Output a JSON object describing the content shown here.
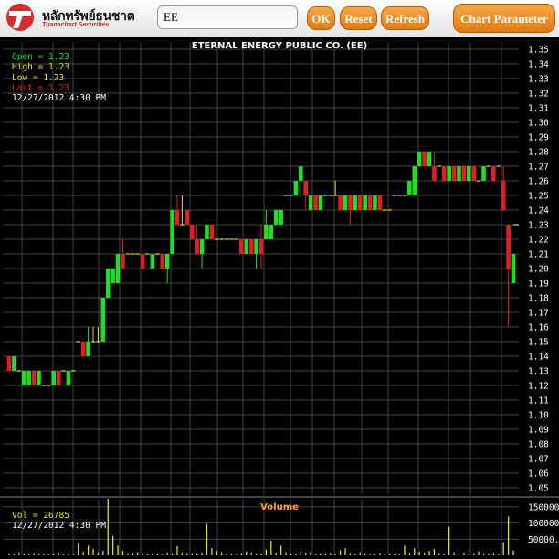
{
  "header": {
    "logo_text": "หลักทรัพย์ธนชาต",
    "logo_subtext": "Thanachart Securities",
    "symbol_value": "EE",
    "ok_label": "OK",
    "reset_label": "Reset",
    "refresh_label": "Refresh",
    "chart_parameter_label": "Chart Parameter"
  },
  "colors": {
    "up": "#22dd22",
    "down": "#e02020",
    "neutral": "#e0e020",
    "volume": "#e0e020",
    "grid": "#5a5a5a",
    "title": "#ffffff",
    "volume_title": "#ffa020",
    "button": "#e88a1a"
  },
  "info": {
    "open_label": "Open  = 1.23",
    "high_label": "High  = 1.23",
    "low_label": "Low   = 1.23",
    "last_label": "Last  = 1.23",
    "datetime": "12/27/2012  4:30 PM",
    "vol_label": "Vol  = 26785",
    "vol_datetime": "12/27/2012  4:30 PM"
  },
  "chart_data": [
    {
      "type": "candlestick",
      "title": "ETERNAL ENERGY PUBLIC CO. (EE)",
      "ylim": [
        1.045,
        1.355
      ],
      "yticks": [
        "1.35",
        "1.34",
        "1.33",
        "1.32",
        "1.31",
        "1.30",
        "1.29",
        "1.28",
        "1.27",
        "1.26",
        "1.25",
        "1.24",
        "1.23",
        "1.22",
        "1.21",
        "1.20",
        "1.19",
        "1.18",
        "1.17",
        "1.16",
        "1.15",
        "1.14",
        "1.13",
        "1.12",
        "1.11",
        "1.10",
        "1.09",
        "1.08",
        "1.07",
        "1.06",
        "1.05"
      ],
      "last_marker": "1.23",
      "grid": true,
      "candles": [
        {
          "o": 1.14,
          "h": 1.14,
          "l": 1.13,
          "c": 1.13
        },
        {
          "o": 1.13,
          "h": 1.14,
          "l": 1.13,
          "c": 1.14
        },
        {
          "o": 1.13,
          "h": 1.13,
          "l": 1.13,
          "c": 1.13
        },
        {
          "o": 1.12,
          "h": 1.13,
          "l": 1.12,
          "c": 1.13
        },
        {
          "o": 1.12,
          "h": 1.13,
          "l": 1.12,
          "c": 1.13
        },
        {
          "o": 1.13,
          "h": 1.13,
          "l": 1.12,
          "c": 1.12
        },
        {
          "o": 1.12,
          "h": 1.13,
          "l": 1.12,
          "c": 1.13
        },
        {
          "o": 1.12,
          "h": 1.12,
          "l": 1.12,
          "c": 1.12
        },
        {
          "o": 1.12,
          "h": 1.12,
          "l": 1.12,
          "c": 1.12
        },
        {
          "o": 1.12,
          "h": 1.13,
          "l": 1.12,
          "c": 1.13
        },
        {
          "o": 1.13,
          "h": 1.13,
          "l": 1.12,
          "c": 1.12
        },
        {
          "o": 1.13,
          "h": 1.13,
          "l": 1.13,
          "c": 1.13
        },
        {
          "o": 1.12,
          "h": 1.13,
          "l": 1.12,
          "c": 1.13
        },
        {
          "o": 1.13,
          "h": 1.13,
          "l": 1.13,
          "c": 1.13
        },
        {
          "o": 1.15,
          "h": 1.15,
          "l": 1.15,
          "c": 1.15
        },
        {
          "o": 1.15,
          "h": 1.15,
          "l": 1.14,
          "c": 1.14
        },
        {
          "o": 1.14,
          "h": 1.16,
          "l": 1.14,
          "c": 1.15
        },
        {
          "o": 1.15,
          "h": 1.16,
          "l": 1.15,
          "c": 1.15
        },
        {
          "o": 1.15,
          "h": 1.16,
          "l": 1.15,
          "c": 1.15
        },
        {
          "o": 1.15,
          "h": 1.18,
          "l": 1.15,
          "c": 1.18
        },
        {
          "o": 1.18,
          "h": 1.2,
          "l": 1.18,
          "c": 1.2
        },
        {
          "o": 1.19,
          "h": 1.2,
          "l": 1.19,
          "c": 1.2
        },
        {
          "o": 1.19,
          "h": 1.21,
          "l": 1.19,
          "c": 1.21
        },
        {
          "o": 1.21,
          "h": 1.22,
          "l": 1.2,
          "c": 1.2
        },
        {
          "o": 1.21,
          "h": 1.21,
          "l": 1.21,
          "c": 1.21
        },
        {
          "o": 1.21,
          "h": 1.21,
          "l": 1.21,
          "c": 1.21
        },
        {
          "o": 1.21,
          "h": 1.21,
          "l": 1.21,
          "c": 1.21
        },
        {
          "o": 1.21,
          "h": 1.21,
          "l": 1.2,
          "c": 1.2
        },
        {
          "o": 1.21,
          "h": 1.21,
          "l": 1.21,
          "c": 1.21
        },
        {
          "o": 1.2,
          "h": 1.21,
          "l": 1.2,
          "c": 1.21
        },
        {
          "o": 1.21,
          "h": 1.21,
          "l": 1.21,
          "c": 1.21
        },
        {
          "o": 1.21,
          "h": 1.21,
          "l": 1.2,
          "c": 1.2
        },
        {
          "o": 1.2,
          "h": 1.21,
          "l": 1.19,
          "c": 1.21
        },
        {
          "o": 1.21,
          "h": 1.24,
          "l": 1.21,
          "c": 1.24
        },
        {
          "o": 1.24,
          "h": 1.25,
          "l": 1.23,
          "c": 1.23
        },
        {
          "o": 1.23,
          "h": 1.25,
          "l": 1.23,
          "c": 1.23
        },
        {
          "o": 1.24,
          "h": 1.24,
          "l": 1.23,
          "c": 1.23
        },
        {
          "o": 1.23,
          "h": 1.23,
          "l": 1.22,
          "c": 1.22
        },
        {
          "o": 1.22,
          "h": 1.23,
          "l": 1.21,
          "c": 1.21
        },
        {
          "o": 1.21,
          "h": 1.22,
          "l": 1.2,
          "c": 1.22
        },
        {
          "o": 1.22,
          "h": 1.23,
          "l": 1.22,
          "c": 1.23
        },
        {
          "o": 1.23,
          "h": 1.23,
          "l": 1.22,
          "c": 1.22
        },
        {
          "o": 1.22,
          "h": 1.22,
          "l": 1.22,
          "c": 1.22
        },
        {
          "o": 1.22,
          "h": 1.22,
          "l": 1.22,
          "c": 1.22
        },
        {
          "o": 1.22,
          "h": 1.22,
          "l": 1.22,
          "c": 1.22
        },
        {
          "o": 1.22,
          "h": 1.22,
          "l": 1.22,
          "c": 1.22
        },
        {
          "o": 1.22,
          "h": 1.22,
          "l": 1.22,
          "c": 1.22
        },
        {
          "o": 1.22,
          "h": 1.22,
          "l": 1.21,
          "c": 1.21
        },
        {
          "o": 1.21,
          "h": 1.22,
          "l": 1.21,
          "c": 1.22
        },
        {
          "o": 1.22,
          "h": 1.22,
          "l": 1.21,
          "c": 1.21
        },
        {
          "o": 1.21,
          "h": 1.22,
          "l": 1.2,
          "c": 1.22
        },
        {
          "o": 1.22,
          "h": 1.23,
          "l": 1.2,
          "c": 1.21
        },
        {
          "o": 1.22,
          "h": 1.24,
          "l": 1.22,
          "c": 1.23
        },
        {
          "o": 1.22,
          "h": 1.23,
          "l": 1.22,
          "c": 1.23
        },
        {
          "o": 1.23,
          "h": 1.24,
          "l": 1.23,
          "c": 1.24
        },
        {
          "o": 1.23,
          "h": 1.24,
          "l": 1.23,
          "c": 1.24
        },
        {
          "o": 1.25,
          "h": 1.25,
          "l": 1.25,
          "c": 1.25
        },
        {
          "o": 1.25,
          "h": 1.25,
          "l": 1.25,
          "c": 1.25
        },
        {
          "o": 1.25,
          "h": 1.26,
          "l": 1.25,
          "c": 1.26
        },
        {
          "o": 1.26,
          "h": 1.27,
          "l": 1.25,
          "c": 1.27
        },
        {
          "o": 1.26,
          "h": 1.26,
          "l": 1.24,
          "c": 1.25
        },
        {
          "o": 1.24,
          "h": 1.25,
          "l": 1.24,
          "c": 1.25
        },
        {
          "o": 1.25,
          "h": 1.25,
          "l": 1.24,
          "c": 1.24
        },
        {
          "o": 1.24,
          "h": 1.25,
          "l": 1.24,
          "c": 1.25
        },
        {
          "o": 1.25,
          "h": 1.25,
          "l": 1.25,
          "c": 1.25
        },
        {
          "o": 1.25,
          "h": 1.25,
          "l": 1.25,
          "c": 1.25
        },
        {
          "o": 1.25,
          "h": 1.26,
          "l": 1.25,
          "c": 1.25
        },
        {
          "o": 1.25,
          "h": 1.25,
          "l": 1.24,
          "c": 1.24
        },
        {
          "o": 1.24,
          "h": 1.25,
          "l": 1.24,
          "c": 1.25
        },
        {
          "o": 1.25,
          "h": 1.25,
          "l": 1.23,
          "c": 1.24
        },
        {
          "o": 1.24,
          "h": 1.25,
          "l": 1.24,
          "c": 1.25
        },
        {
          "o": 1.25,
          "h": 1.25,
          "l": 1.24,
          "c": 1.24
        },
        {
          "o": 1.24,
          "h": 1.25,
          "l": 1.24,
          "c": 1.25
        },
        {
          "o": 1.25,
          "h": 1.25,
          "l": 1.24,
          "c": 1.24
        },
        {
          "o": 1.24,
          "h": 1.25,
          "l": 1.24,
          "c": 1.25
        },
        {
          "o": 1.25,
          "h": 1.25,
          "l": 1.24,
          "c": 1.24
        },
        {
          "o": 1.24,
          "h": 1.24,
          "l": 1.24,
          "c": 1.24
        },
        {
          "o": 1.24,
          "h": 1.24,
          "l": 1.24,
          "c": 1.24
        },
        {
          "o": 1.25,
          "h": 1.25,
          "l": 1.25,
          "c": 1.25
        },
        {
          "o": 1.25,
          "h": 1.25,
          "l": 1.25,
          "c": 1.25
        },
        {
          "o": 1.25,
          "h": 1.25,
          "l": 1.25,
          "c": 1.25
        },
        {
          "o": 1.25,
          "h": 1.26,
          "l": 1.25,
          "c": 1.26
        },
        {
          "o": 1.25,
          "h": 1.27,
          "l": 1.25,
          "c": 1.27
        },
        {
          "o": 1.27,
          "h": 1.28,
          "l": 1.27,
          "c": 1.28
        },
        {
          "o": 1.28,
          "h": 1.28,
          "l": 1.27,
          "c": 1.27
        },
        {
          "o": 1.27,
          "h": 1.28,
          "l": 1.27,
          "c": 1.28
        },
        {
          "o": 1.27,
          "h": 1.28,
          "l": 1.26,
          "c": 1.26
        },
        {
          "o": 1.27,
          "h": 1.27,
          "l": 1.27,
          "c": 1.27
        },
        {
          "o": 1.27,
          "h": 1.27,
          "l": 1.26,
          "c": 1.26
        },
        {
          "o": 1.26,
          "h": 1.27,
          "l": 1.26,
          "c": 1.27
        },
        {
          "o": 1.27,
          "h": 1.27,
          "l": 1.26,
          "c": 1.26
        },
        {
          "o": 1.26,
          "h": 1.27,
          "l": 1.26,
          "c": 1.27
        },
        {
          "o": 1.27,
          "h": 1.27,
          "l": 1.26,
          "c": 1.26
        },
        {
          "o": 1.26,
          "h": 1.27,
          "l": 1.26,
          "c": 1.27
        },
        {
          "o": 1.27,
          "h": 1.27,
          "l": 1.26,
          "c": 1.26
        },
        {
          "o": 1.26,
          "h": 1.26,
          "l": 1.26,
          "c": 1.26
        },
        {
          "o": 1.26,
          "h": 1.27,
          "l": 1.26,
          "c": 1.27
        },
        {
          "o": 1.27,
          "h": 1.27,
          "l": 1.27,
          "c": 1.27
        },
        {
          "o": 1.27,
          "h": 1.27,
          "l": 1.26,
          "c": 1.26
        },
        {
          "o": 1.27,
          "h": 1.27,
          "l": 1.27,
          "c": 1.27
        },
        {
          "o": 1.26,
          "h": 1.27,
          "l": 1.24,
          "c": 1.24
        },
        {
          "o": 1.23,
          "h": 1.23,
          "l": 1.16,
          "c": 1.2
        },
        {
          "o": 1.19,
          "h": 1.21,
          "l": 1.19,
          "c": 1.21
        }
      ]
    },
    {
      "type": "bar",
      "title": "Volume",
      "ylim": [
        0,
        175000
      ],
      "yticks": [
        "150000.",
        "100000.",
        "50000.0"
      ],
      "values": [
        5000,
        4000,
        9000,
        6000,
        3000,
        7000,
        5000,
        4000,
        3000,
        6000,
        8000,
        4000,
        5000,
        3000,
        38000,
        12000,
        30000,
        20000,
        9000,
        14000,
        175000,
        60000,
        30000,
        14000,
        6000,
        8000,
        10000,
        5000,
        4000,
        7000,
        5000,
        4000,
        9000,
        6000,
        28000,
        9000,
        7000,
        6000,
        5000,
        8000,
        98000,
        22000,
        14000,
        10000,
        6000,
        5000,
        4000,
        7000,
        12000,
        9000,
        5000,
        6000,
        18000,
        45000,
        8000,
        30000,
        10000,
        6000,
        5000,
        14000,
        9000,
        12000,
        4000,
        6000,
        5000,
        8000,
        4000,
        16000,
        22000,
        7000,
        5000,
        9000,
        6000,
        4000,
        5000,
        8000,
        4000,
        6000,
        5000,
        4000,
        30000,
        8000,
        22000,
        11000,
        9000,
        14000,
        20000,
        7000,
        5000,
        88000,
        10000,
        6000,
        9000,
        4000,
        7000,
        12000,
        6000,
        5000,
        8000,
        3000,
        40000,
        120000,
        15000
      ]
    }
  ]
}
